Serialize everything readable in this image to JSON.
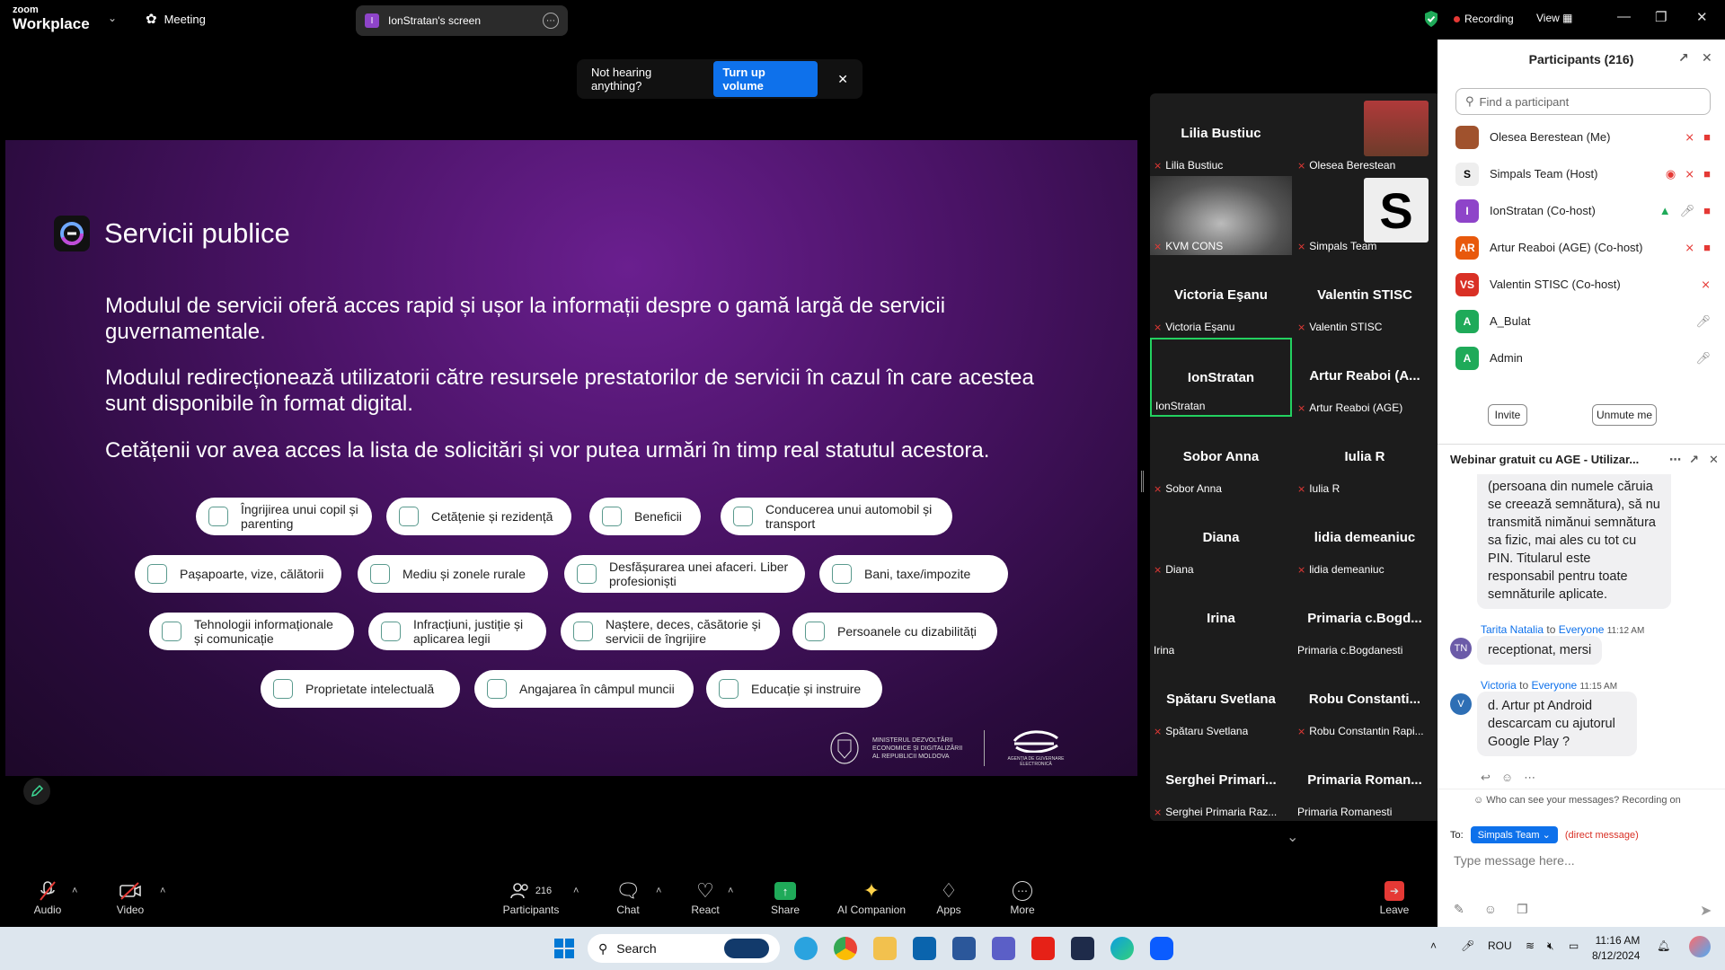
{
  "topbar": {
    "logo_small": "zoom",
    "logo_big": "Workplace",
    "meeting_label": "Meeting",
    "screen_share_label": "IonStratan's screen",
    "screen_share_avatar": "I",
    "recording_label": "Recording",
    "view_label": "View"
  },
  "volume_banner": {
    "text": "Not hearing anything?",
    "button": "Turn up volume"
  },
  "slide": {
    "title": "Servicii publice",
    "paragraphs": [
      "Modulul de servicii oferă acces rapid și ușor la informații despre o gamă largă de servicii guvernamentale.",
      "Modulul redirecționează utilizatorii către resursele prestatorilor de servicii în cazul în care acestea sunt disponibile în format digital.",
      "Cetățenii vor avea acces la lista de solicitări și vor putea urmări în timp real statutul acestora."
    ],
    "chips": [
      "Îngrijirea unui copil și parenting",
      "Cetățenie și rezidență",
      "Beneficii",
      "Conducerea unui automobil și transport",
      "Pașapoarte, vize, călătorii",
      "Mediu și zonele rurale",
      "Desfășurarea unei afaceri. Liber profesioniști",
      "Bani, taxe/impozite",
      "Tehnologii informaționale și comunicație",
      "Infracțiuni, justiție și aplicarea legii",
      "Naștere, deces, căsătorie și servicii de îngrijire",
      "Persoanele cu dizabilități",
      "Proprietate intelectuală",
      "Angajarea în câmpul muncii",
      "Educație și instruire"
    ],
    "footer_ministry": "MINISTERUL DEZVOLTĂRII ECONOMICE ȘI DIGITALIZĂRII AL REPUBLICII MOLDOVA",
    "footer_agency": "AGENȚIA DE GUVERNARE ELECTRONICĂ"
  },
  "gallery": [
    {
      "name": "Lilia Bustiuc",
      "label": "Lilia Bustiuc",
      "muted": true
    },
    {
      "name": "",
      "label": "Olesea Berestean",
      "muted": true
    },
    {
      "name": "",
      "label": "KVM CONS",
      "muted": true
    },
    {
      "name": "",
      "label": "Simpals Team",
      "muted": true
    },
    {
      "name": "Victoria Eşanu",
      "label": "Victoria Eşanu",
      "muted": true
    },
    {
      "name": "Valentin STISC",
      "label": "Valentin STISC",
      "muted": true
    },
    {
      "name": "IonStratan",
      "label": "IonStratan",
      "muted": false
    },
    {
      "name": "Artur Reaboi (A...",
      "label": "Artur Reaboi (AGE)",
      "muted": true
    },
    {
      "name": "Sobor Anna",
      "label": "Sobor Anna",
      "muted": true
    },
    {
      "name": "Iulia R",
      "label": "Iulia R",
      "muted": true
    },
    {
      "name": "Diana",
      "label": "Diana",
      "muted": true
    },
    {
      "name": "lidia demeaniuc",
      "label": "lidia demeaniuc",
      "muted": true
    },
    {
      "name": "Irina",
      "label": "Irina",
      "muted": false
    },
    {
      "name": "Primaria c.Bogd...",
      "label": "Primaria c.Bogdanesti",
      "muted": false
    },
    {
      "name": "Spătaru Svetlana",
      "label": "Spătaru Svetlana",
      "muted": true
    },
    {
      "name": "Robu Constanti...",
      "label": "Robu Constantin Rapi...",
      "muted": true
    },
    {
      "name": "Serghei Primari...",
      "label": "Serghei Primaria Raz...",
      "muted": true
    },
    {
      "name": "Primaria Roman...",
      "label": "Primaria Romanesti",
      "muted": false
    }
  ],
  "participants": {
    "title": "Participants (216)",
    "search_placeholder": "Find a participant",
    "list": [
      {
        "name": "Olesea Berestean (Me)",
        "avatar": "",
        "color": "#a0522d"
      },
      {
        "name": "Simpals Team (Host)",
        "avatar": "S",
        "color": "#333333"
      },
      {
        "name": "IonStratan (Co-host)",
        "avatar": "I",
        "color": "#8e44c9"
      },
      {
        "name": "Artur Reaboi (AGE) (Co-host)",
        "avatar": "AR",
        "color": "#e8590c"
      },
      {
        "name": "Valentin STISC (Co-host)",
        "avatar": "VS",
        "color": "#d93025"
      },
      {
        "name": "A_Bulat",
        "avatar": "A",
        "color": "#1faa59"
      },
      {
        "name": "Admin",
        "avatar": "A",
        "color": "#1faa59"
      }
    ],
    "invite": "Invite",
    "unmute": "Unmute me"
  },
  "chat": {
    "title": "Webinar gratuit cu AGE - Utilizar...",
    "first_msg": "(persoana din numele căruia se creează semnătura), să nu transmită nimănui semnătura sa fizic, mai ales cu tot cu PIN. Titularul este responsabil pentru toate semnăturile aplicate.",
    "msg2_sender": "Tarita Natalia",
    "msg2_to_word": "to",
    "msg2_to": "Everyone",
    "msg2_time": "11:12 AM",
    "msg2_text": "receptionat, mersi",
    "msg2_avatar": "TN",
    "msg3_sender": "Victoria",
    "msg3_to_word": "to",
    "msg3_to": "Everyone",
    "msg3_time": "11:15 AM",
    "msg3_text": "d. Artur pt Android descarcam cu ajutorul Google Play ?",
    "msg3_avatar": "V",
    "visibility_note": "Who can see your messages? Recording on",
    "to_label": "To:",
    "to_recipient": "Simpals Team",
    "direct_note": "(direct message)",
    "input_placeholder": "Type message here..."
  },
  "toolbar": {
    "audio": "Audio",
    "video": "Video",
    "participants": "Participants",
    "participants_count": "216",
    "chat": "Chat",
    "react": "React",
    "share": "Share",
    "ai": "AI Companion",
    "apps": "Apps",
    "more": "More",
    "leave": "Leave"
  },
  "taskbar": {
    "search": "Search",
    "lang": "ROU",
    "time": "11:16 AM",
    "date": "8/12/2024"
  }
}
